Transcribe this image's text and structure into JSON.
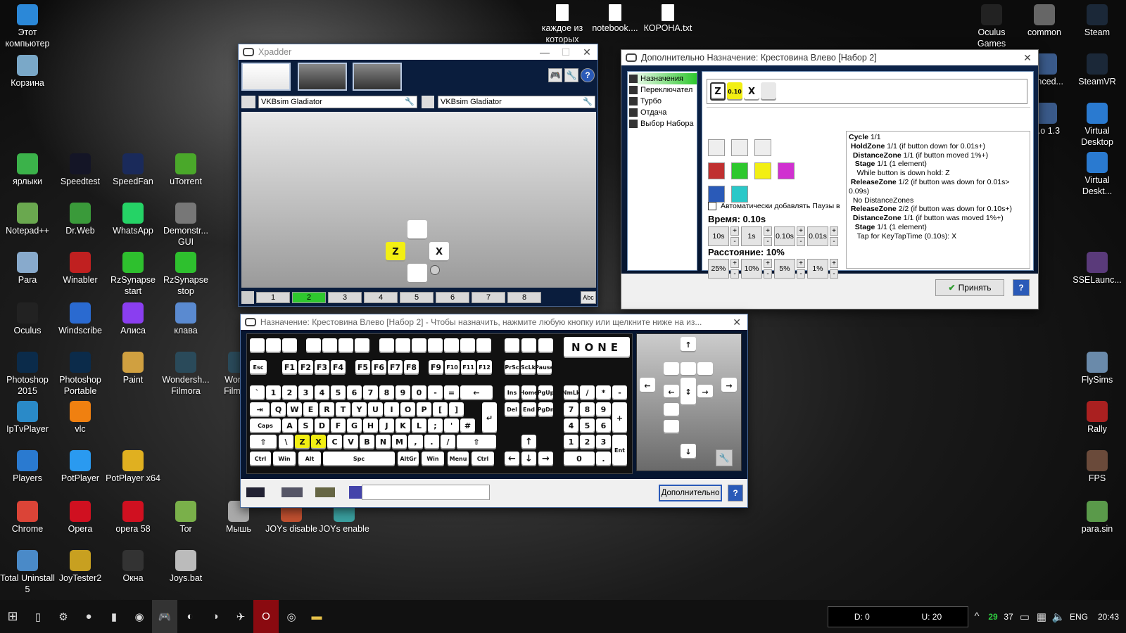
{
  "desktop_left": [
    {
      "label": "Этот компьютер",
      "icon": "computer-icon",
      "color": "#2b88d8"
    },
    {
      "label": "Корзина",
      "icon": "recycle-bin-icon",
      "color": "#7aa8c8"
    },
    {
      "label": "ярлыки",
      "icon": "shortcut-folder-icon",
      "color": "#3bb24a"
    },
    {
      "label": "Speedtest",
      "icon": "speedtest-icon",
      "color": "#141526"
    },
    {
      "label": "SpeedFan",
      "icon": "speedfan-icon",
      "color": "#1a2a5a"
    },
    {
      "label": "uTorrent",
      "icon": "utorrent-icon",
      "color": "#4aa82a"
    },
    {
      "label": "Notepad++",
      "icon": "notepadpp-icon",
      "color": "#6aa84f"
    },
    {
      "label": "Dr.Web",
      "icon": "drweb-icon",
      "color": "#3a9a3a"
    },
    {
      "label": "WhatsApp",
      "icon": "whatsapp-icon",
      "color": "#25d366"
    },
    {
      "label": "Demonstr... GUI",
      "icon": "chip-icon",
      "color": "#777"
    },
    {
      "label": "Para",
      "icon": "para-icon",
      "color": "#88aacc"
    },
    {
      "label": "Winabler",
      "icon": "winabler-icon",
      "color": "#c02020"
    },
    {
      "label": "RzSynapse start",
      "icon": "razer-icon",
      "color": "#2ec02e"
    },
    {
      "label": "RzSynapse stop",
      "icon": "razer-icon",
      "color": "#2ec02e"
    },
    {
      "label": "Oculus",
      "icon": "oculus-icon",
      "color": "#222"
    },
    {
      "label": "Windscribe",
      "icon": "windscribe-icon",
      "color": "#2a6ad0"
    },
    {
      "label": "Алиса",
      "icon": "alice-icon",
      "color": "#8a3ef0"
    },
    {
      "label": "клава",
      "icon": "keyboard-icon",
      "color": "#5a8ad0"
    },
    {
      "label": "Photoshop 2015",
      "icon": "photoshop-icon",
      "color": "#0b2b4a"
    },
    {
      "label": "Photoshop Portable",
      "icon": "photoshop-icon",
      "color": "#0b2b4a"
    },
    {
      "label": "Paint",
      "icon": "paint-icon",
      "color": "#d0a040"
    },
    {
      "label": "Wondersh... Filmora",
      "icon": "filmora-icon",
      "color": "#2a4a5a"
    },
    {
      "label": "Wonde Filmora",
      "icon": "filmora-icon",
      "color": "#2a4a5a"
    },
    {
      "label": "IpTvPlayer",
      "icon": "tv-icon",
      "color": "#2a8ac8"
    },
    {
      "label": "vlc",
      "icon": "vlc-icon",
      "color": "#f08010"
    },
    {
      "label": "Players",
      "icon": "play-icon",
      "color": "#2a7ad0"
    },
    {
      "label": "PotPlayer",
      "icon": "play-icon",
      "color": "#2a9af0"
    },
    {
      "label": "PotPlayer x64",
      "icon": "potplayer-icon",
      "color": "#e0b020"
    },
    {
      "label": "Chrome",
      "icon": "chrome-icon",
      "color": "#db4437"
    },
    {
      "label": "Opera",
      "icon": "opera-icon",
      "color": "#d01020"
    },
    {
      "label": "opera 58",
      "icon": "opera-icon",
      "color": "#d01020"
    },
    {
      "label": "Tor",
      "icon": "tor-icon",
      "color": "#7ab04a"
    },
    {
      "label": "Мышь",
      "icon": "mouse-icon",
      "color": "#aaa"
    },
    {
      "label": "JOYs disable",
      "icon": "joystick-icon",
      "color": "#c05030"
    },
    {
      "label": "JOYs enable",
      "icon": "joystick-icon",
      "color": "#3aa0a0"
    },
    {
      "label": "Total Uninstall 5",
      "icon": "uninstall-icon",
      "color": "#4a8ac8"
    },
    {
      "label": "JoyTester2",
      "icon": "joytester-icon",
      "color": "#c8a020"
    },
    {
      "label": "Окна",
      "icon": "gear-icon",
      "color": "#333"
    },
    {
      "label": "Joys.bat",
      "icon": "bat-file-icon",
      "color": "#bbb"
    }
  ],
  "desktop_top": [
    {
      "label": "каждое из которых",
      "icon": "text-file-icon"
    },
    {
      "label": "notebook....",
      "icon": "text-file-icon"
    },
    {
      "label": "КОРОНА.txt",
      "icon": "text-file-icon"
    }
  ],
  "desktop_right": [
    {
      "label": "Oculus Games",
      "icon": "oculus-icon",
      "color": "#222"
    },
    {
      "label": "common",
      "icon": "gamepad-icon",
      "color": "#666"
    },
    {
      "label": "Steam",
      "icon": "steam-icon",
      "color": "#1b2838"
    },
    {
      "label": "...nced...",
      "icon": "app-icon",
      "color": "#3a5a8a"
    },
    {
      "label": "SteamVR",
      "icon": "steamvr-icon",
      "color": "#1b2838"
    },
    {
      "label": "...o 1.3",
      "icon": "app-icon",
      "color": "#3a5a8a"
    },
    {
      "label": "Virtual Desktop",
      "icon": "monitor-icon",
      "color": "#2a7ad0"
    },
    {
      "label": "Virtual Deskt...",
      "icon": "monitor-icon",
      "color": "#2a7ad0"
    },
    {
      "label": "SSELaunc...",
      "icon": "app-icon",
      "color": "#5a3a7a"
    },
    {
      "label": "FlySims",
      "icon": "plane-icon",
      "color": "#6a8aaa"
    },
    {
      "label": "Rally",
      "icon": "rally-icon",
      "color": "#aa2020"
    },
    {
      "label": "FPS",
      "icon": "fps-icon",
      "color": "#6a4a3a"
    },
    {
      "label": "para.sin",
      "icon": "file-icon",
      "color": "#5a9a4a"
    }
  ],
  "xpadder": {
    "title": "Xpadder",
    "controller_name": "VKBsim Gladiator",
    "profile_name": "VKBsim Gladiator",
    "keys": {
      "left": "Z",
      "right": "X"
    },
    "sets": [
      "1",
      "2",
      "3",
      "4",
      "5",
      "6",
      "7",
      "8"
    ],
    "active_set": "2",
    "abc": "Abc"
  },
  "advanced": {
    "title": "Дополнительно Назначение: Крестовина Влево [Набор 2]",
    "menu": [
      "Назначения",
      "Переключател",
      "Турбо",
      "Отдача",
      "Выбор Набора"
    ],
    "slots": [
      "Z",
      "0.10",
      "X"
    ],
    "auto_pause": "Автоматически добавлять Паузы в",
    "time_label": "Время: 0.10s",
    "time_steps": [
      "10s",
      "1s",
      "0.10s",
      "0.01s"
    ],
    "dist_label": "Расстояние: 10%",
    "dist_steps": [
      "25%",
      "10%",
      "5%",
      "1%"
    ],
    "info": [
      {
        "b": "Cycle",
        "t": " 1/1"
      },
      {
        "b": " HoldZone",
        "t": " 1/1 (if button down for 0.01s+)"
      },
      {
        "b": "  DistanceZone",
        "t": " 1/1 (if button moved 1%+)"
      },
      {
        "b": "   Stage",
        "t": " 1/1 (1 element)"
      },
      {
        "b": "",
        "t": "    While button is down hold: Z"
      },
      {
        "b": " ReleaseZone",
        "t": " 1/2 (if button was down for 0.01s> 0.09s)"
      },
      {
        "b": "",
        "t": "  No DistanceZones"
      },
      {
        "b": " ReleaseZone",
        "t": " 2/2 (if button was down for 0.10s+)"
      },
      {
        "b": "  DistanceZone",
        "t": " 1/1 (if button was moved 1%+)"
      },
      {
        "b": "   Stage",
        "t": " 1/1 (1 element)"
      },
      {
        "b": "",
        "t": "    Tap for KeyTapTime (0.10s): X"
      }
    ],
    "accept": "Принять",
    "help": "?"
  },
  "assign": {
    "title": "Назначение: Крестовина Влево [Набор 2] - Чтобы назначить, нажмите любую кнопку или щелкните ниже на из...",
    "none": "NONE",
    "fkeys": [
      "Esc",
      "F1",
      "F2",
      "F3",
      "F4",
      "F5",
      "F6",
      "F7",
      "F8",
      "F9",
      "F10",
      "F11",
      "F12",
      "PrSc",
      "ScLk",
      "Pause"
    ],
    "row1": [
      "`",
      "1",
      "2",
      "3",
      "4",
      "5",
      "6",
      "7",
      "8",
      "9",
      "0",
      "-",
      "=",
      "←"
    ],
    "row2": [
      "⇥",
      "Q",
      "W",
      "E",
      "R",
      "T",
      "Y",
      "U",
      "I",
      "O",
      "P",
      "[",
      "]",
      "↵"
    ],
    "row3": [
      "Caps",
      "A",
      "S",
      "D",
      "F",
      "G",
      "H",
      "J",
      "K",
      "L",
      ";",
      "'",
      "#"
    ],
    "row4": [
      "⇧",
      "\\",
      "Z",
      "X",
      "C",
      "V",
      "B",
      "N",
      "M",
      ",",
      ".",
      "/",
      "⇧"
    ],
    "row5": [
      "Ctrl",
      "Win",
      "Alt",
      "Spc",
      "AltGr",
      "Win",
      "Menu",
      "Ctrl"
    ],
    "nav": [
      "Ins",
      "Home",
      "PgUp",
      "Del",
      "End",
      "PgDn"
    ],
    "numpad": [
      "NmLk",
      "/",
      "*",
      "-",
      "7",
      "8",
      "9",
      "+",
      "4",
      "5",
      "6",
      "1",
      "2",
      "3",
      "Ent",
      "0",
      "."
    ],
    "advanced_btn": "Дополнительно",
    "help": "?"
  },
  "taskbar": {
    "d_label": "D: 0",
    "u_label": "U: 20",
    "tray_green": "29",
    "tray_white": "37",
    "lang": "ENG",
    "time": "20:43"
  }
}
